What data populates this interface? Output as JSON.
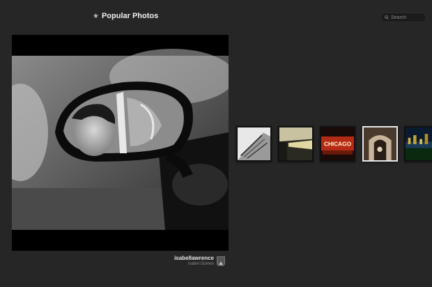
{
  "header": {
    "title": "Popular Photos",
    "star_icon": "star-icon"
  },
  "search": {
    "placeholder": "Search",
    "icon": "search-icon"
  },
  "featured": {
    "username": "isabellawrence",
    "full_name": "Isabel Gomes"
  },
  "thumbnails": [
    {
      "id": "thumb-1",
      "subject": "building",
      "selected": false
    },
    {
      "id": "thumb-2",
      "subject": "subway-tunnel",
      "selected": false
    },
    {
      "id": "thumb-3",
      "subject": "chicago-sign",
      "label": "CHICAGO",
      "selected": false
    },
    {
      "id": "thumb-4",
      "subject": "archway",
      "selected": true
    },
    {
      "id": "thumb-5",
      "subject": "city-night",
      "selected": false
    }
  ],
  "colors": {
    "background": "#262626",
    "selected_border": "#e8e8e8"
  }
}
